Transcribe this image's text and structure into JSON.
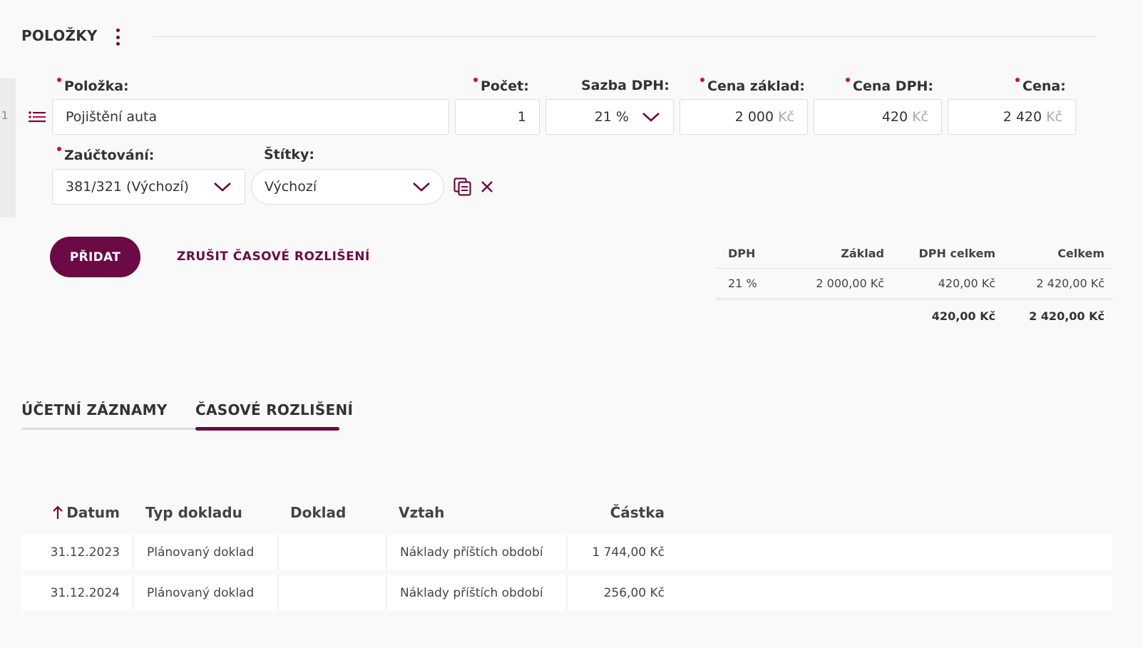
{
  "section": {
    "title": "POLOŽKY"
  },
  "row_number": "1",
  "labels": {
    "item": "Položka:",
    "count": "Počet:",
    "vat_rate": "Sazba DPH:",
    "base_price": "Cena základ:",
    "vat_price": "Cena DPH:",
    "price": "Cena:",
    "posting": "Zaúčtování:",
    "tags": "Štítky:"
  },
  "fields": {
    "item": "Pojištění auta",
    "count": "1",
    "vat_rate": "21 %",
    "base_price": "2 000",
    "vat_price": "420",
    "price": "2 420",
    "currency": "Kč",
    "posting": "381/321 (Výchozí)",
    "tags": "Výchozí"
  },
  "actions": {
    "add": "PŘIDAT",
    "cancel_accrual": "ZRUŠIT ČASOVÉ ROZLIŠENÍ"
  },
  "vat_summary": {
    "headers": [
      "DPH",
      "Základ",
      "DPH celkem",
      "Celkem"
    ],
    "rows": [
      [
        "21 %",
        "2 000,00 Kč",
        "420,00 Kč",
        "2 420,00 Kč"
      ]
    ],
    "totals": [
      "420,00 Kč",
      "2 420,00 Kč"
    ]
  },
  "tabs": [
    "ÚČETNÍ ZÁZNAMY",
    "ČASOVÉ ROZLIŠENÍ"
  ],
  "active_tab": 1,
  "accrual_table": {
    "headers": [
      "Datum",
      "Typ dokladu",
      "Doklad",
      "Vztah",
      "Částka"
    ],
    "rows": [
      [
        "31.12.2023",
        "Plánovaný doklad",
        "",
        "Náklady příštích období",
        "1 744,00 Kč"
      ],
      [
        "31.12.2024",
        "Plánovaný doklad",
        "",
        "Náklady příštích období",
        "256,00 Kč"
      ]
    ]
  },
  "colors": {
    "accent": "#6b0a45",
    "required": "#c8103e"
  },
  "icons": [
    "kebab-menu-icon",
    "drag-handle-icon",
    "chevron-down-icon",
    "copy-icon",
    "close-icon",
    "sort-ascending-icon"
  ]
}
